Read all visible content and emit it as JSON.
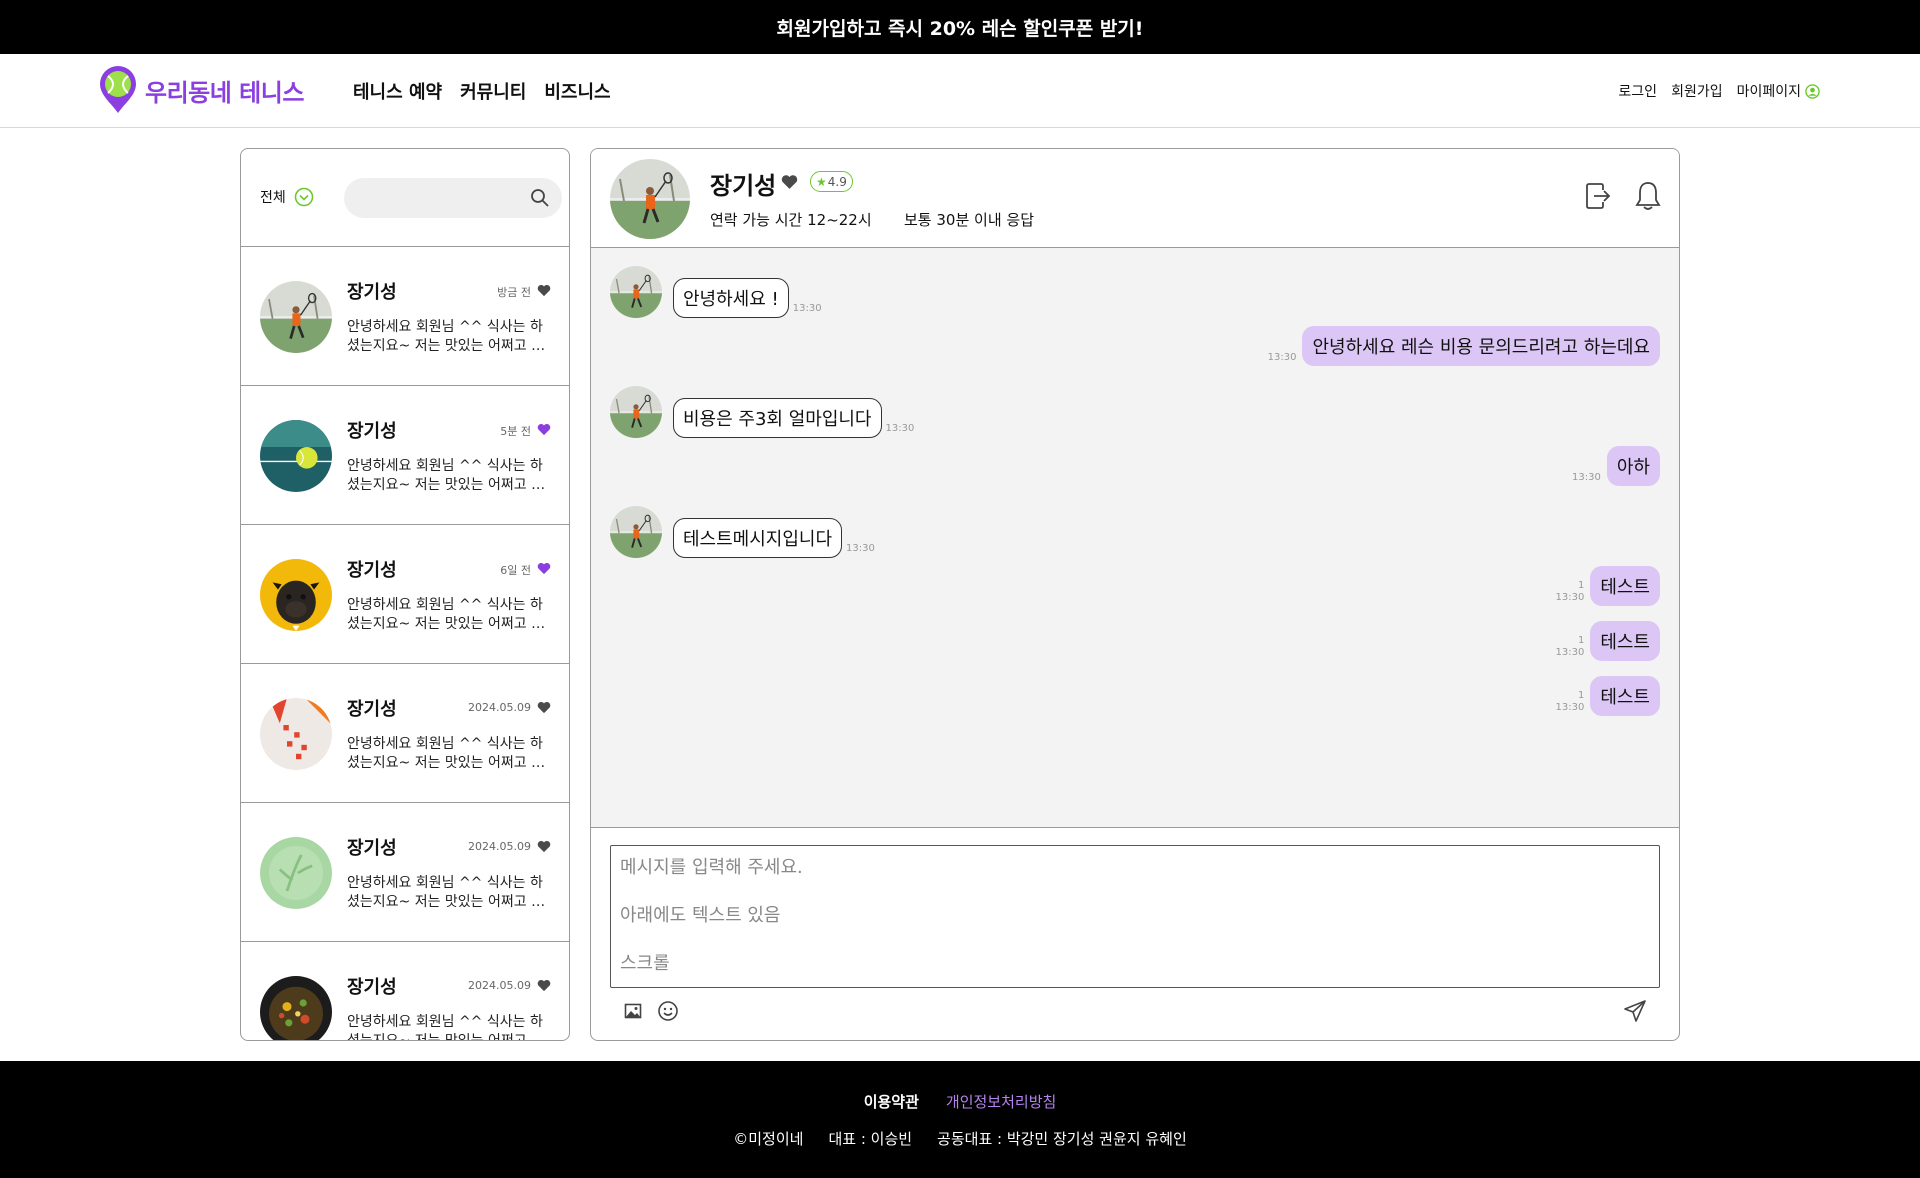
{
  "promo": {
    "text": "회원가입하고 즉시 20% 레슨 할인쿠폰 받기!"
  },
  "header": {
    "logo_text": "우리동네 테니스",
    "nav": [
      "테니스 예약",
      "커뮤니티",
      "비즈니스"
    ],
    "auth": {
      "login": "로그인",
      "signup": "회원가입",
      "mypage": "마이페이지"
    }
  },
  "sidebar": {
    "filter_label": "전체",
    "search_placeholder": "",
    "items": [
      {
        "name": "장기성",
        "time": "방금 전",
        "liked": false,
        "message": "안녕하세요 회원님 ^^ 식사는 하셨는지요~ 저는 맛있는 어쩌고 저쩌고",
        "avatar": "tennis-player"
      },
      {
        "name": "장기성",
        "time": "5분 전",
        "liked": true,
        "message": "안녕하세요 회원님 ^^ 식사는 하셨는지요~ 저는 맛있는 어쩌고 저쩌고",
        "avatar": "tennis-ball"
      },
      {
        "name": "장기성",
        "time": "6일 전",
        "liked": true,
        "message": "안녕하세요 회원님 ^^ 식사는 하셨는지요~ 저는 맛있는 어쩌고 저쩌고",
        "avatar": "pug"
      },
      {
        "name": "장기성",
        "time": "2024.05.09",
        "liked": false,
        "message": "안녕하세요 회원님 ^^ 식사는 하셨는지요~ 저는 맛있는 어쩌고 저쩌고",
        "avatar": "red-cards"
      },
      {
        "name": "장기성",
        "time": "2024.05.09",
        "liked": false,
        "message": "안녕하세요 회원님 ^^ 식사는 하셨는지요~ 저는 맛있는 어쩌고 저쩌고",
        "avatar": "green-plant"
      },
      {
        "name": "장기성",
        "time": "2024.05.09",
        "liked": false,
        "message": "안녕하세요 회원님 ^^ 식사는 하셨는지요~ 저는 맛있는 어쩌고 저쩌고",
        "avatar": "food-bowl"
      }
    ]
  },
  "chat": {
    "name": "장기성",
    "rating": "4.9",
    "hours": "연락 가능 시간 12~22시",
    "response": "보통 30분 이내 응답",
    "messages": [
      {
        "dir": "in",
        "text": "안녕하세요 !",
        "time": "13:30"
      },
      {
        "dir": "out",
        "text": "안녕하세요 레슨 비용 문의드리려고 하는데요",
        "time": "13:30",
        "unread": ""
      },
      {
        "dir": "in",
        "text": "비용은 주3회 얼마입니다",
        "time": "13:30"
      },
      {
        "dir": "out",
        "text": "아하",
        "time": "13:30",
        "unread": ""
      },
      {
        "dir": "in",
        "text": "테스트메시지입니다",
        "time": "13:30"
      },
      {
        "dir": "out",
        "text": "테스트",
        "time": "13:30",
        "unread": "1"
      },
      {
        "dir": "out",
        "text": "테스트",
        "time": "13:30",
        "unread": "1"
      },
      {
        "dir": "out",
        "text": "테스트",
        "time": "13:30",
        "unread": "1"
      }
    ],
    "composer_text": "메시지를 입력해 주세요.\n\n아래에도 텍스트 있음\n\n스크롤"
  },
  "footer": {
    "terms": "이용약관",
    "privacy": "개인정보처리방침",
    "copyright": "©미정이네",
    "ceo": "대표 : 이승빈",
    "co_ceo": "공동대표 : 박강민 장기성 권윤지 유혜인"
  },
  "colors": {
    "brand": "#8b3fe0",
    "accent_green": "#6bc92c",
    "bubble_out": "#dcc6f5",
    "heart_active": "#8b3fe0",
    "heart_inactive": "#4a4a4a"
  }
}
